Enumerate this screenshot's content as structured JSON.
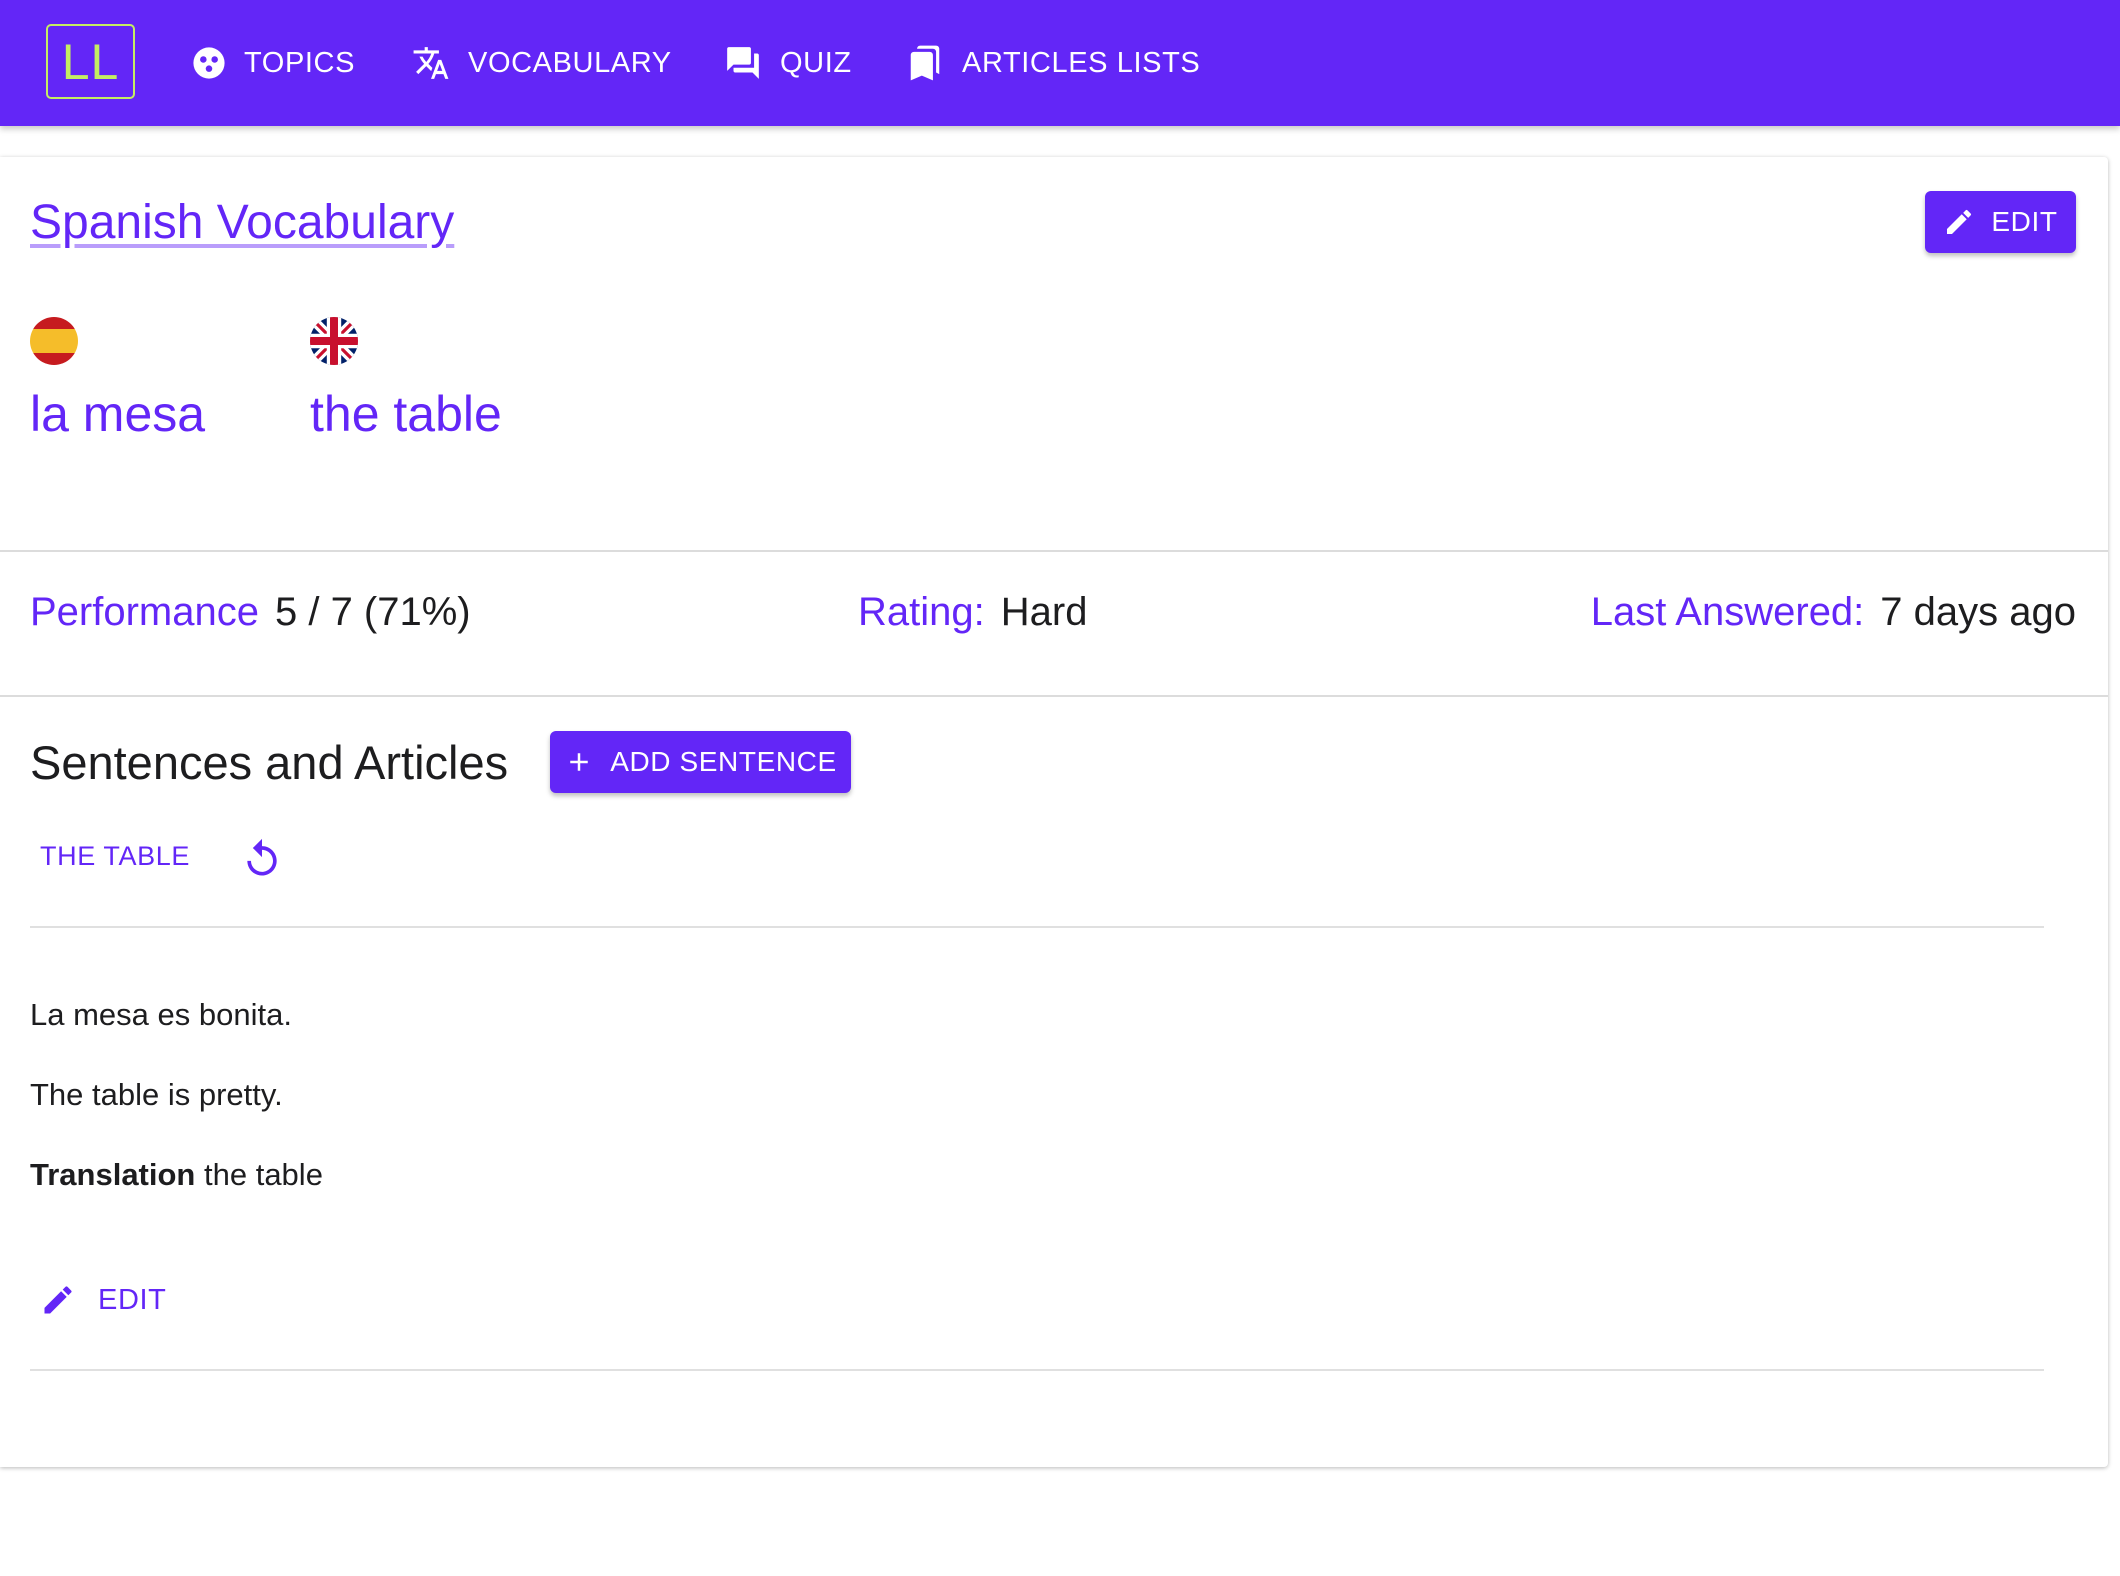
{
  "app": {
    "logo": "LL",
    "colors": {
      "primary": "#6326f7",
      "logo_accent": "#c4ee62"
    }
  },
  "nav": [
    {
      "label": "TOPICS",
      "icon": "topics-icon"
    },
    {
      "label": "VOCABULARY",
      "icon": "translate-icon"
    },
    {
      "label": "QUIZ",
      "icon": "forum-icon"
    },
    {
      "label": "ARTICLES LISTS",
      "icon": "bookmarks-icon"
    }
  ],
  "card": {
    "topic_link": "Spanish Vocabulary",
    "edit_label": "EDIT",
    "words": [
      {
        "flag": "spain-flag-icon",
        "text": "la mesa"
      },
      {
        "flag": "uk-flag-icon",
        "text": "the table"
      }
    ],
    "stats": {
      "performance_label": "Performance",
      "performance_value": "5 / 7 (71%)",
      "rating_label": "Rating:",
      "rating_value": "Hard",
      "last_answered_label": "Last Answered:",
      "last_answered_value": "7 days ago"
    },
    "sentences_section": {
      "title": "Sentences and Articles",
      "add_label": "ADD SENTENCE",
      "tab_label": "THE TABLE",
      "sentence_original": "La mesa es bonita.",
      "sentence_translation": "The table is pretty.",
      "translation_label": "Translation",
      "translation_value": "the table",
      "edit_label": "EDIT"
    }
  }
}
